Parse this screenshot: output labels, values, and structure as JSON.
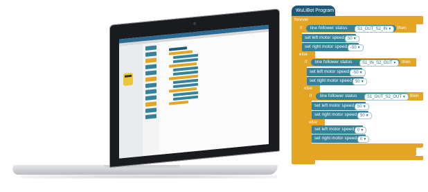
{
  "program": {
    "title": "WuLiBot Program",
    "forever": "forever",
    "if_kw": "if",
    "then_kw": "then",
    "else_kw": "else",
    "cond1_label": "line follower status",
    "cond1_value": "S1_OUT_S2_IN",
    "left_label": "set  left motor speed",
    "right_label": "set  right motor speed",
    "b1_left": "50",
    "b1_right": "-50",
    "cond2_label": "line follower status",
    "cond2_value": "S1_IN_S2_OUT",
    "b2_left": "-50",
    "b2_right": "50",
    "cond3_label": "line follower status",
    "cond3_value": "S1_OUT_S2_OUT",
    "b3_left": "50",
    "b3_right": "50",
    "b4_left": "0",
    "b4_right": "0"
  },
  "colors": {
    "control": "#e3a523",
    "motion": "#35839a",
    "hat": "#1e5a78"
  }
}
